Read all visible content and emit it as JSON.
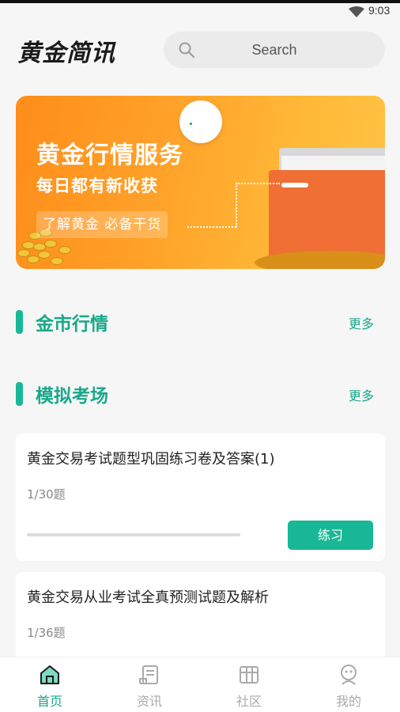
{
  "status_bar": {
    "time": "9:03",
    "wifi_icon": "wifi-icon"
  },
  "header": {
    "logo_text": "黄金简讯",
    "search_placeholder": "Search",
    "search_icon": "search-icon"
  },
  "banner": {
    "title": "黄金行情服务",
    "subtitle": "每日都有新收获",
    "tag": "了解黄金  必备干货"
  },
  "sections": {
    "market": {
      "title": "金市行情",
      "more": "更多"
    },
    "exam": {
      "title": "模拟考场",
      "more": "更多"
    }
  },
  "exams": [
    {
      "title": "黄金交易考试题型巩固练习卷及答案(1)",
      "count": "1/30题",
      "progress": 0,
      "button": "练习"
    },
    {
      "title": "黄金交易从业考试全真预测试题及解析",
      "count": "1/36题"
    }
  ],
  "tabbar": {
    "items": [
      {
        "label": "首页",
        "icon": "home-icon",
        "active": true
      },
      {
        "label": "资讯",
        "icon": "news-icon",
        "active": false
      },
      {
        "label": "社区",
        "icon": "community-icon",
        "active": false
      },
      {
        "label": "我的",
        "icon": "profile-icon",
        "active": false
      }
    ]
  },
  "colors": {
    "accent": "#18b896",
    "banner_orange": "#ff8d1a"
  }
}
